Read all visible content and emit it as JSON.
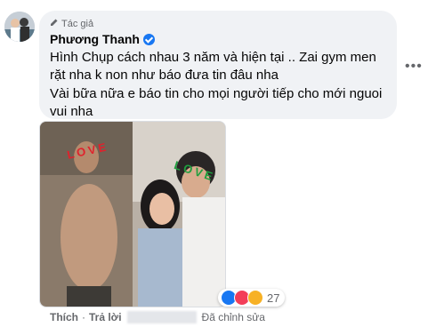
{
  "comment": {
    "role_label": "Tác giả",
    "author_name": "Phương Thanh",
    "text_lines": [
      "Hình Chụp cách nhau 3 năm và hiện tại .. Zai gym men",
      "rặt nha k non như báo đưa tin đâu nha",
      "Vài bữa nữa e báo tin cho mọi người tiếp cho mới nguoi",
      "vui nha"
    ],
    "reaction_count": "27",
    "reaction_icons": [
      "like-icon",
      "love-icon",
      "wow-icon"
    ],
    "actions": {
      "like_label": "Thích",
      "reply_label": "Trả lời",
      "edited_label": "Đã chỉnh sửa",
      "separator": "·"
    },
    "photo_stickers": [
      "LOVE",
      "LOVE"
    ]
  },
  "colors": {
    "bubble_bg": "#f0f2f5",
    "verified_blue": "#1877f2",
    "muted_text": "#65676b",
    "like_blue": "#1877f2",
    "love_red": "#f33e58",
    "wow_yellow": "#f7b125"
  }
}
